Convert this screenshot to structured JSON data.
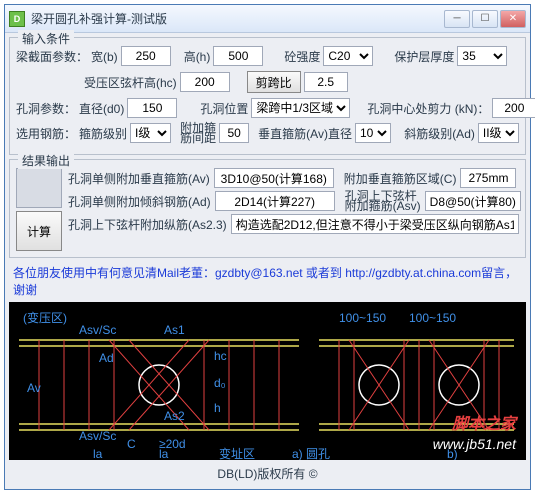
{
  "window": {
    "title": "梁开圆孔补强计算-测试版"
  },
  "groups": {
    "input": "输入条件",
    "output": "结果输出"
  },
  "inp": {
    "section_label": "梁截面参数：",
    "width_label": "宽(b)",
    "width": "250",
    "height_label": "高(h)",
    "height": "500",
    "concrete_label": "砼强度",
    "concrete": "C20",
    "cover_label": "保护层厚度",
    "cover": "35",
    "comp_label": "受压区弦杆高(hc)",
    "comp": "200",
    "shear_ratio_label": "剪跨比",
    "shear_ratio": "2.5",
    "hole_label": "孔洞参数：",
    "dia_label": "直径(d0)",
    "dia": "150",
    "pos_label": "孔洞位置",
    "pos": "梁跨中1/3区域",
    "shear_label": "孔洞中心处剪力 (kN)：",
    "shear": "200",
    "steel_label": "选用钢筋：",
    "stirrup_grade_label": "箍筋级别",
    "stirrup_grade": "I级",
    "stirrup_spacing_label": "附加箍\n筋间距",
    "stirrup_spacing": "50",
    "vert_dia_label": "垂直箍筋(Av)直径",
    "vert_dia": "10",
    "diag_grade_label": "斜筋级别(Ad)",
    "diag_grade": "II级"
  },
  "out": {
    "calc": "计算",
    "av_label": "孔洞单侧附加垂直箍筋(Av)",
    "av": "3D10@50(计算168)",
    "c_label": "附加垂直箍筋区域(C)",
    "c": "275mm",
    "ad_label": "孔洞单侧附加倾斜钢筋(Ad)",
    "ad": "2D14(计算227)",
    "asv_label": "孔洞上下弦杆\n附加箍筋(Asv)",
    "asv": "D8@50(计算80)",
    "as_label": "孔洞上下弦杆附加纵筋(As2.3)",
    "as": "构造选配2D12,但注意不得小于梁受压区纵向钢筋As1"
  },
  "note": "各位朋友使用中有何意见清Mail老董：gzdbty@163.net 或者到 http://gzdbty.at.china.com留言，谢谢",
  "footer": "DB(LD)版权所有 ©",
  "watermark": {
    "line1": "脚本之家",
    "line2": "www.jb51.net"
  }
}
